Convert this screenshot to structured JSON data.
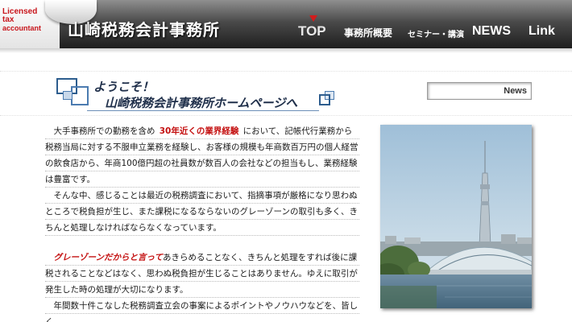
{
  "header": {
    "logo_lines": [
      "Licensed",
      "tax",
      "accountant"
    ],
    "site_title": "山崎税務会計事務所"
  },
  "nav": {
    "top": "TOP",
    "office": "事務所概要",
    "seminar": "セミナー・講演",
    "news": "NEWS",
    "link": "Link"
  },
  "welcome": {
    "line1": "ようこそ！",
    "line2": "山崎税務会計事務所ホームページへ"
  },
  "content": {
    "p1_before": "大手事務所での勤務を含め",
    "p1_highlight": "30年近くの業界経験",
    "p1_after": "において、記帳代行業務から税務当局に対する不服申立業務を経験し、お客様の規模も年商数百万円の個人経営の飲食店から、年商100億円超の社員数が数百人の会社などの担当もし、業務経験は豊富です。",
    "p2": "そんな中、感じることは最近の税務調査において、指摘事項が厳格になり思わぬところで税負担が生じ、また課税になるならないのグレーゾーンの取引も多く、きちんと処理しなければならなくなっています。",
    "p3_highlight": "グレーゾーンだからと言って",
    "p3_after": "あきらめることなく、きちんと処理をすれば後に課税されることなどはなく、思わぬ税負担が生じることはありません。ゆえに取引が発生した時の処理が大切になります。",
    "p4": "年間数十件こなした税務調査立会の事案によるポイントやノウハウなどを、皆しく"
  },
  "sidebar": {
    "news_label": "News"
  },
  "colors": {
    "accent_red": "#c41010",
    "header_dark": "#1e1e1e",
    "banner_blue": "#2d5d8e"
  }
}
